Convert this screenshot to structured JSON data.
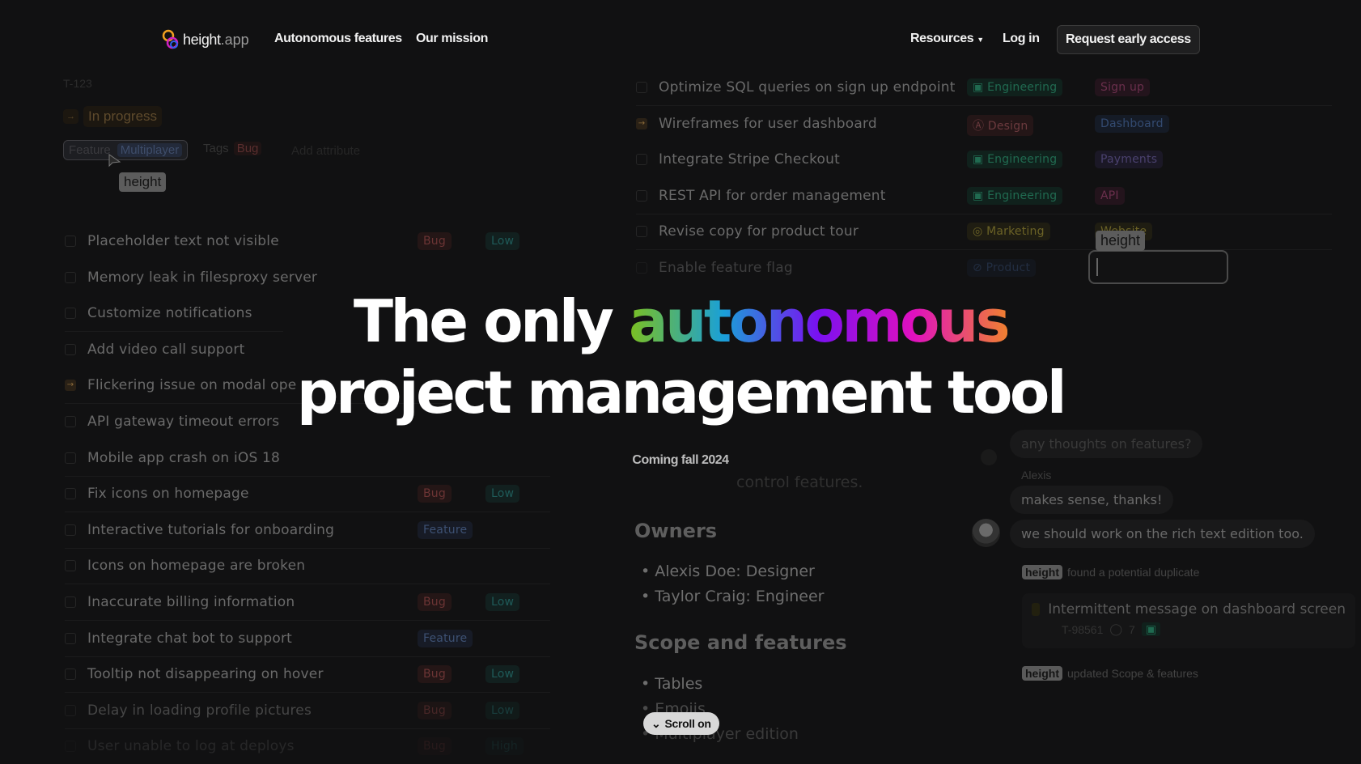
{
  "nav": {
    "logo_text": "height",
    "logo_suffix": ".app",
    "links": [
      "Autonomous features",
      "Our mission"
    ],
    "resources": "Resources",
    "login": "Log in",
    "cta": "Request early access"
  },
  "task_panel": {
    "id": "T-123",
    "status": "In progress",
    "feature_label": "Feature",
    "feature_value": "Multiplayer",
    "tags_label": "Tags",
    "tags_value": "Bug",
    "add_attribute": "Add attribute",
    "cursor_label": "height"
  },
  "left_list": [
    {
      "title": "Placeholder text not visible",
      "tags": [
        "Bug",
        "Low"
      ]
    },
    {
      "title": "Memory leak in filesproxy server",
      "tags": []
    },
    {
      "title": "Customize notifications",
      "tags": []
    },
    {
      "title": "Add video call support",
      "tags": []
    },
    {
      "title": "Flickering issue on modal ope",
      "tags": [],
      "in_progress": true
    },
    {
      "title": "API gateway timeout errors",
      "tags": []
    },
    {
      "title": "Mobile app crash on iOS 18",
      "tags": []
    },
    {
      "title": "Fix icons on homepage",
      "tags": [
        "Bug",
        "Low"
      ]
    },
    {
      "title": "Interactive tutorials for onboarding",
      "tags": [
        "Feature"
      ]
    },
    {
      "title": "Icons on homepage are broken",
      "tags": []
    },
    {
      "title": "Inaccurate billing information",
      "tags": [
        "Bug",
        "Low"
      ]
    },
    {
      "title": "Integrate chat bot to support",
      "tags": [
        "Feature"
      ]
    },
    {
      "title": "Tooltip not disappearing on hover",
      "tags": [
        "Bug",
        "Low"
      ]
    },
    {
      "title": "Delay in loading profile pictures",
      "tags": [
        "Bug",
        "Low"
      ]
    },
    {
      "title": "User unable to log at deploys",
      "tags": [
        "Bug",
        "High"
      ]
    }
  ],
  "right_list": [
    {
      "title": "Optimize SQL queries on sign up endpoint",
      "team": "Engineering",
      "tag": "Sign up"
    },
    {
      "title": "Wireframes for user dashboard",
      "team": "Design",
      "tag": "Dashboard",
      "in_progress": true
    },
    {
      "title": "Integrate Stripe Checkout",
      "team": "Engineering",
      "tag": "Payments"
    },
    {
      "title": "REST API for order management",
      "team": "Engineering",
      "tag": "API"
    },
    {
      "title": "Revise copy for product tour",
      "team": "Marketing",
      "tag": "Website"
    },
    {
      "title": "Enable feature flag",
      "team": "Product",
      "tag": ""
    }
  ],
  "editing_cursor_label": "height",
  "hero": {
    "line1_prefix": "The only ",
    "line1_highlight": "autonomous",
    "line2": "project management tool",
    "subtitle": "Coming fall 2024",
    "gradient": [
      "#7cc020",
      "#1aa0d8",
      "#7a10f0",
      "#e010c0",
      "#f08030"
    ]
  },
  "doc": {
    "faded_text": "control features.",
    "owners_heading": "Owners",
    "owners": [
      "Alexis Doe: Designer",
      "Taylor Craig: Engineer"
    ],
    "scope_heading": "Scope and features",
    "scope": [
      "Tables",
      "Emojis",
      "Multiplayer edition"
    ]
  },
  "scroll_button": "Scroll on",
  "chat": {
    "msg1": "any thoughts on features?",
    "author": "Alexis",
    "msg2": "makes sense, thanks!",
    "msg3": "we should work on the rich text edition too.",
    "bot_name": "height",
    "event1": "found a potential duplicate",
    "dup_title": "Intermittent message on dashboard screen",
    "dup_id": "T-98561",
    "dup_comments": "7",
    "event2": "updated Scope & features"
  }
}
